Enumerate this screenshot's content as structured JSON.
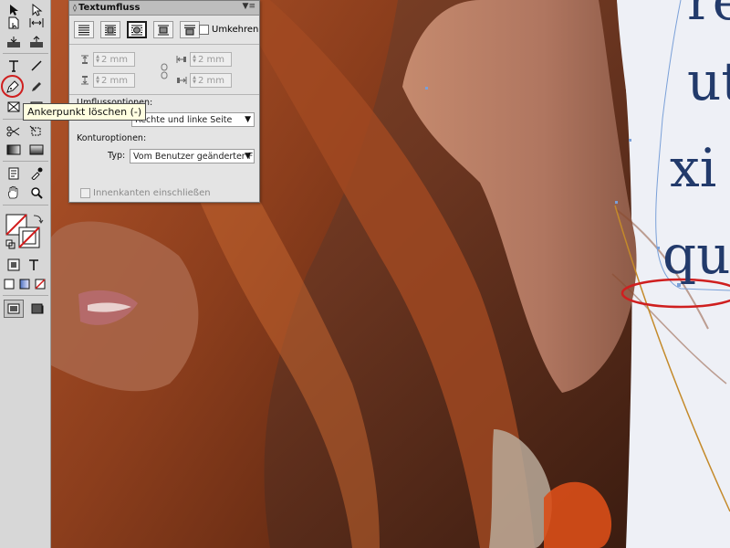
{
  "panel": {
    "title": "Textumfluss",
    "menu_icon": "panel-menu-icon",
    "invert_label": "Umkehren",
    "offsets": {
      "top": "2 mm",
      "bottom": "2 mm",
      "left": "2 mm",
      "right": "2 mm"
    },
    "wrap_options_label": "Umflussoptionen:",
    "wrap_to_value": "Rechte und linke Seite",
    "contour_options_label": "Konturoptionen:",
    "type_label": "Typ:",
    "type_value": "Vom Benutzer geänderter F",
    "include_inside_edges_label": "Innenkanten einschließen"
  },
  "tooltip": {
    "text": "Ankerpunkt löschen (-)"
  },
  "canvas": {
    "text_lines": [
      "re",
      "ut",
      "xi",
      "qu"
    ],
    "colors": {
      "text": "#223a6b",
      "highlight_circle": "#cf1f1f",
      "frame_line": "#c48a2a",
      "path_line": "#7aa0d8"
    }
  },
  "tools": [
    "selection-tool-icon",
    "direct-selection-tool-icon",
    "page-tool-icon",
    "gap-tool-icon",
    "content-collector-icon",
    "content-placer-icon",
    "type-tool-icon",
    "line-tool-icon",
    "pen-tool-icon",
    "pencil-tool-icon",
    "rectangle-frame-tool-icon",
    "rectangle-tool-icon",
    "scissors-tool-icon",
    "free-transform-tool-icon",
    "gradient-swatch-tool-icon",
    "gradient-feather-tool-icon",
    "note-tool-icon",
    "eyedropper-tool-icon",
    "hand-tool-icon",
    "zoom-tool-icon",
    "fill-stroke-icon",
    "formatting-affects-container-icon",
    "formatting-affects-text-icon",
    "apply-color-icon",
    "apply-gradient-icon",
    "apply-none-icon",
    "normal-mode-icon",
    "preview-mode-icon"
  ]
}
